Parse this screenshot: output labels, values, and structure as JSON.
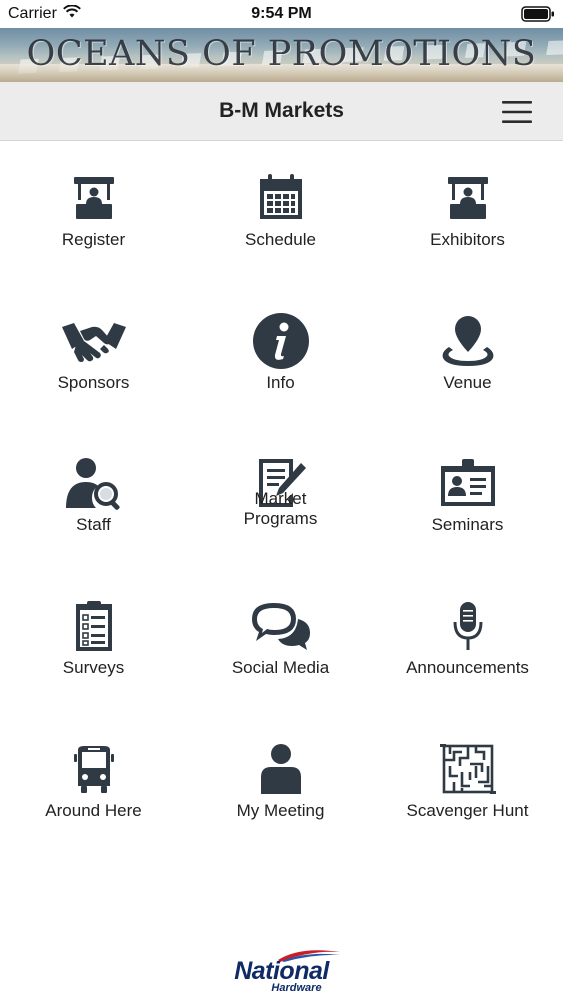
{
  "status_bar": {
    "carrier": "Carrier",
    "time": "9:54 PM"
  },
  "banner": {
    "text": "OCEANS OF PROMOTIONS"
  },
  "nav": {
    "title": "B-M Markets",
    "menu_icon": "hamburger-menu-icon"
  },
  "tiles": [
    {
      "label": "Register",
      "icon": "kiosk-booth-icon"
    },
    {
      "label": "Schedule",
      "icon": "calendar-icon"
    },
    {
      "label": "Exhibitors",
      "icon": "kiosk-booth-icon"
    },
    {
      "label": "Sponsors",
      "icon": "handshake-icon"
    },
    {
      "label": "Info",
      "icon": "info-icon"
    },
    {
      "label": "Venue",
      "icon": "map-pin-icon"
    },
    {
      "label": "Staff",
      "icon": "person-search-icon"
    },
    {
      "label": "Market\nPrograms",
      "icon": "document-pen-icon"
    },
    {
      "label": "Seminars",
      "icon": "id-badge-icon"
    },
    {
      "label": "Surveys",
      "icon": "clipboard-checklist-icon"
    },
    {
      "label": "Social Media",
      "icon": "chat-bubbles-icon"
    },
    {
      "label": "Announcements",
      "icon": "microphone-icon"
    },
    {
      "label": "Around Here",
      "icon": "bus-icon"
    },
    {
      "label": "My Meeting",
      "icon": "person-icon"
    },
    {
      "label": "Scavenger Hunt",
      "icon": "maze-icon"
    }
  ],
  "footer": {
    "brand": "National",
    "sub": "Hardware"
  },
  "colors": {
    "icon": "#2f3a44",
    "nav_bg": "#ececec",
    "brand_blue": "#0f2a66"
  }
}
